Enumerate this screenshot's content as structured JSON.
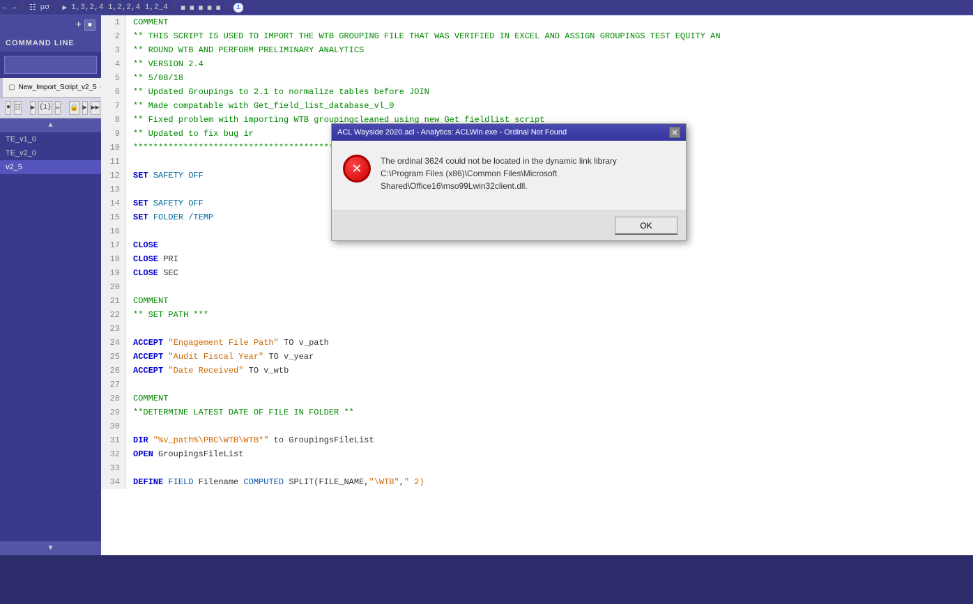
{
  "toolbar": {
    "label": "COMMAND LINE"
  },
  "tabs": [
    {
      "label": "New_Import_Script_v2_5",
      "active": true
    }
  ],
  "sidebar": {
    "items": [
      {
        "label": "TE_v1_0",
        "active": false
      },
      {
        "label": "TE_v2_0",
        "active": false
      },
      {
        "label": "v2_5",
        "active": true
      }
    ]
  },
  "editor": {
    "lines": [
      {
        "num": "1",
        "content": "COMMENT",
        "type": "comment"
      },
      {
        "num": "2",
        "content": "** THIS SCRIPT IS USED TO IMPORT THE WTB GROUPING FILE THAT WAS VERIFIED IN EXCEL AND ASSIGN GROUPINGS TEST EQUITY AN",
        "type": "comment"
      },
      {
        "num": "3",
        "content": "** ROUND WTB AND PERFORM PRELIMINARY ANALYTICS",
        "type": "comment"
      },
      {
        "num": "4",
        "content": "** VERSION 2.4",
        "type": "comment"
      },
      {
        "num": "5",
        "content": "** 5/08/18",
        "type": "comment"
      },
      {
        "num": "6",
        "content": "** Updated Groupings to 2.1 to normalize tables before JOIN",
        "type": "comment"
      },
      {
        "num": "7",
        "content": "** Made compatable with Get_field_list_database_vl_0",
        "type": "comment"
      },
      {
        "num": "8",
        "content": "** Fixed problem with importing WTB groupingcleaned using new Get fieldlist script",
        "type": "comment"
      },
      {
        "num": "9",
        "content": "** Updated to fix bug ir",
        "type": "comment_dots"
      },
      {
        "num": "10",
        "content": "***************************",
        "type": "dots"
      },
      {
        "num": "11",
        "content": "",
        "type": "plain"
      },
      {
        "num": "12",
        "content": "SET SAFETY OFF",
        "type": "keyword"
      },
      {
        "num": "13",
        "content": "",
        "type": "plain"
      },
      {
        "num": "14",
        "content": "SET SAFETY OFF",
        "type": "keyword"
      },
      {
        "num": "15",
        "content": "SET FOLDER /TEMP",
        "type": "keyword"
      },
      {
        "num": "16",
        "content": "",
        "type": "plain"
      },
      {
        "num": "17",
        "content": "CLOSE",
        "type": "keyword_only"
      },
      {
        "num": "18",
        "content": "CLOSE PRI",
        "type": "keyword_only"
      },
      {
        "num": "19",
        "content": "CLOSE SEC",
        "type": "keyword_only"
      },
      {
        "num": "20",
        "content": "",
        "type": "plain"
      },
      {
        "num": "21",
        "content": "COMMENT",
        "type": "comment_kw"
      },
      {
        "num": "22",
        "content": "** SET PATH ***",
        "type": "comment"
      },
      {
        "num": "23",
        "content": "",
        "type": "plain"
      },
      {
        "num": "24",
        "content": "ACCEPT \"Engagement File Path\" TO v_path",
        "type": "accept"
      },
      {
        "num": "25",
        "content": "ACCEPT \"Audit Fiscal Year\" TO v_year",
        "type": "accept"
      },
      {
        "num": "26",
        "content": "ACCEPT \"Date Received\" TO v_wtb",
        "type": "accept"
      },
      {
        "num": "27",
        "content": "",
        "type": "plain"
      },
      {
        "num": "28",
        "content": "COMMENT",
        "type": "comment_kw"
      },
      {
        "num": "29",
        "content": "**DETERMINE LATEST DATE OF FILE IN FOLDER **",
        "type": "comment"
      },
      {
        "num": "30",
        "content": "",
        "type": "plain"
      },
      {
        "num": "31",
        "content": "DIR \"%v_path%\\PBC\\WTB\\WTB*\" to GroupingsFileList",
        "type": "dir"
      },
      {
        "num": "32",
        "content": "OPEN GroupingsFileList",
        "type": "open"
      },
      {
        "num": "33",
        "content": "",
        "type": "plain"
      },
      {
        "num": "34",
        "content": "DEFINE FIELD Filename COMPUTED SPLIT(FILE_NAME,\"\\WTB\",\" 2)",
        "type": "define"
      }
    ]
  },
  "dialog": {
    "title": "ACL Wayside 2020.acl - Analytics: ACLWin.exe - Ordinal Not Found",
    "message_line1": "The ordinal 3624 could not be located in the dynamic link library",
    "message_line2": "C:\\Program Files (x86)\\Common Files\\Microsoft",
    "message_line3": "Shared\\Office16\\mso99Lwin32client.dll.",
    "ok_label": "OK"
  }
}
